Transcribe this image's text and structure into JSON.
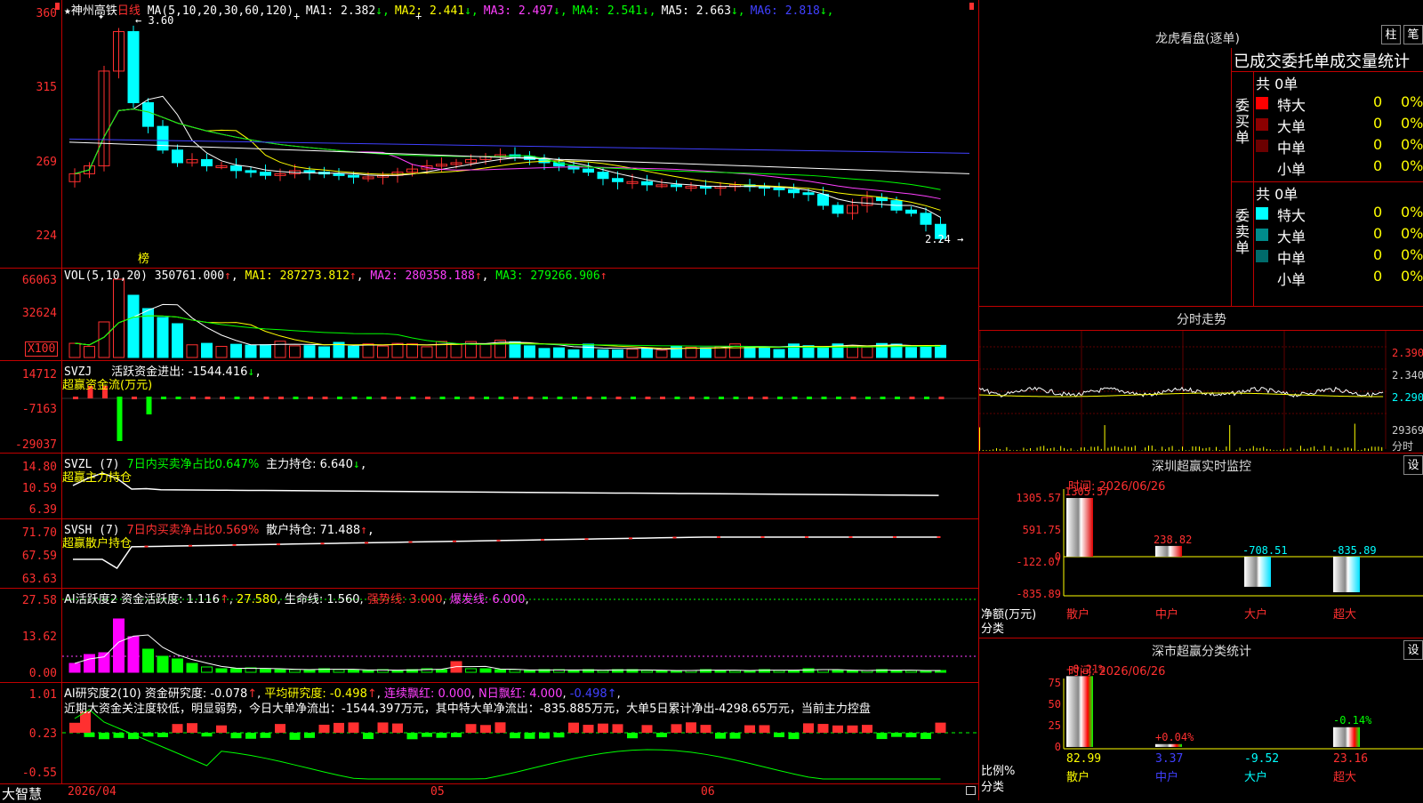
{
  "stock_name": "神州高铁",
  "period_label": "日线",
  "main": {
    "ma_params": "MA(5,10,20,30,60,120)",
    "ma_values": [
      {
        "label": "MA1:",
        "value": "2.382",
        "color": "#ffffff"
      },
      {
        "label": "MA2:",
        "value": "2.441",
        "color": "#ffff00"
      },
      {
        "label": "MA3:",
        "value": "2.497",
        "color": "#ff40ff"
      },
      {
        "label": "MA4:",
        "value": "2.541",
        "color": "#00ff00"
      },
      {
        "label": "MA5:",
        "value": "2.663",
        "color": "#ffffff"
      },
      {
        "label": "MA6:",
        "value": "2.818",
        "color": "#4040ff"
      }
    ],
    "y_ticks": [
      "360",
      "315",
      "269",
      "224"
    ],
    "high_label": "3.60",
    "last_label": "2.24",
    "bang_label": "榜"
  },
  "vol": {
    "title": "VOL(5,10,20)",
    "value": "350761.000",
    "ma1": "MA1: 287273.812",
    "ma2": "MA2: 280358.188",
    "ma3": "MA3: 279266.906",
    "y_ticks": [
      "66063",
      "32624"
    ],
    "unit": "X100"
  },
  "svzj": {
    "title": "SVZJ",
    "text": "活跃资金进出: -1544.416",
    "sub": "超赢资金流(万元)",
    "y_ticks": [
      "14712",
      "-7163",
      "-29037"
    ]
  },
  "svzl": {
    "title": "SVZL (7)",
    "text1": "7日内买卖净占比0.647%",
    "text2": "主力持仓: 6.640",
    "sub": "超赢主力持仓",
    "y_ticks": [
      "14.80",
      "10.59",
      "6.39"
    ]
  },
  "svsh": {
    "title": "SVSH (7)",
    "text1": "7日内买卖净占比0.569%",
    "text2": "散户持仓: 71.488",
    "sub": "超赢散户持仓",
    "y_ticks": [
      "71.70",
      "67.59",
      "63.63"
    ]
  },
  "ai1": {
    "title": "AI活跃度2",
    "t1": "资金活跃度: 1.116",
    "t2": "27.580",
    "t3": "生命线: 1.560",
    "t4": "强势线: 3.000",
    "t5": "爆发线: 6.000",
    "y_ticks": [
      "27.58",
      "13.62",
      "0.00"
    ]
  },
  "ai2": {
    "title": "AI研究度2(10)",
    "t1": "资金研究度: -0.078",
    "t2": "平均研究度: -0.498",
    "t3": "连续飘红: 0.000",
    "t4": "N日飘红: 4.000",
    "t5": "-0.498",
    "note": "近期大资金关注度较低，明显弱势，今日大单净流出：-1544.397万元，其中特大单净流出：-835.885万元，大单5日累计净出-4298.65万元，当前主力控盘",
    "y_ticks": [
      "1.01",
      "0.23",
      "-0.55"
    ]
  },
  "xaxis": {
    "app": "大智慧",
    "d1": "2026/04",
    "d2": "05",
    "d3": "06"
  },
  "lhb": {
    "title": "龙虎看盘(逐单)",
    "btn1": "柱",
    "btn2": "笔",
    "header": "已成交委托单成交量统计",
    "buy_label": "委买单",
    "sell_label": "委卖单",
    "buy_total": "共 0单",
    "sell_total": "共 0单",
    "buy_rows": [
      {
        "name": "特大",
        "v": "0",
        "p": "0%",
        "c": "#ff0000"
      },
      {
        "name": "大单",
        "v": "0",
        "p": "0%",
        "c": "#8b0000"
      },
      {
        "name": "中单",
        "v": "0",
        "p": "0%",
        "c": "#6b0000"
      },
      {
        "name": "小单",
        "v": "0",
        "p": "0%",
        "c": ""
      }
    ],
    "sell_rows": [
      {
        "name": "特大",
        "v": "0",
        "p": "0%",
        "c": "#00ffff"
      },
      {
        "name": "大单",
        "v": "0",
        "p": "0%",
        "c": "#008b8b"
      },
      {
        "name": "中单",
        "v": "0",
        "p": "0%",
        "c": "#006b6b"
      },
      {
        "name": "小单",
        "v": "0",
        "p": "0%",
        "c": ""
      }
    ]
  },
  "intraday": {
    "title": "分时走势",
    "y": [
      "2.390",
      "2.340",
      "2.290"
    ],
    "vol": "29369",
    "vol_lbl": "分时"
  },
  "monitor": {
    "title": "深圳超赢实时监控",
    "btn": "设",
    "time": "时间: 2026/06/26",
    "y": [
      "1305.57",
      "591.75",
      "-122.07",
      "-835.89"
    ],
    "zero": "0",
    "ylabel": "净额(万元)",
    "xlabel": "分类",
    "bars": [
      {
        "cat": "散户",
        "val": "1305.57"
      },
      {
        "cat": "中户",
        "val": "238.82"
      },
      {
        "cat": "大户",
        "val": "-708.51"
      },
      {
        "cat": "超大",
        "val": "-835.89"
      }
    ]
  },
  "classstat": {
    "title": "深市超赢分类统计",
    "btn": "设",
    "time": "时间: 2026/06/26",
    "y": [
      "75",
      "50",
      "25",
      "0"
    ],
    "ylabel": "比例%",
    "xlabel": "分类",
    "bars": [
      {
        "cat": "散户",
        "pct": "+0.21%",
        "val": "82.99"
      },
      {
        "cat": "中户",
        "pct": "+0.04%",
        "val": "3.37"
      },
      {
        "cat": "大户",
        "pct": "",
        "val": "-9.52"
      },
      {
        "cat": "超大",
        "pct": "-0.14%",
        "val": "23.16"
      }
    ]
  }
}
